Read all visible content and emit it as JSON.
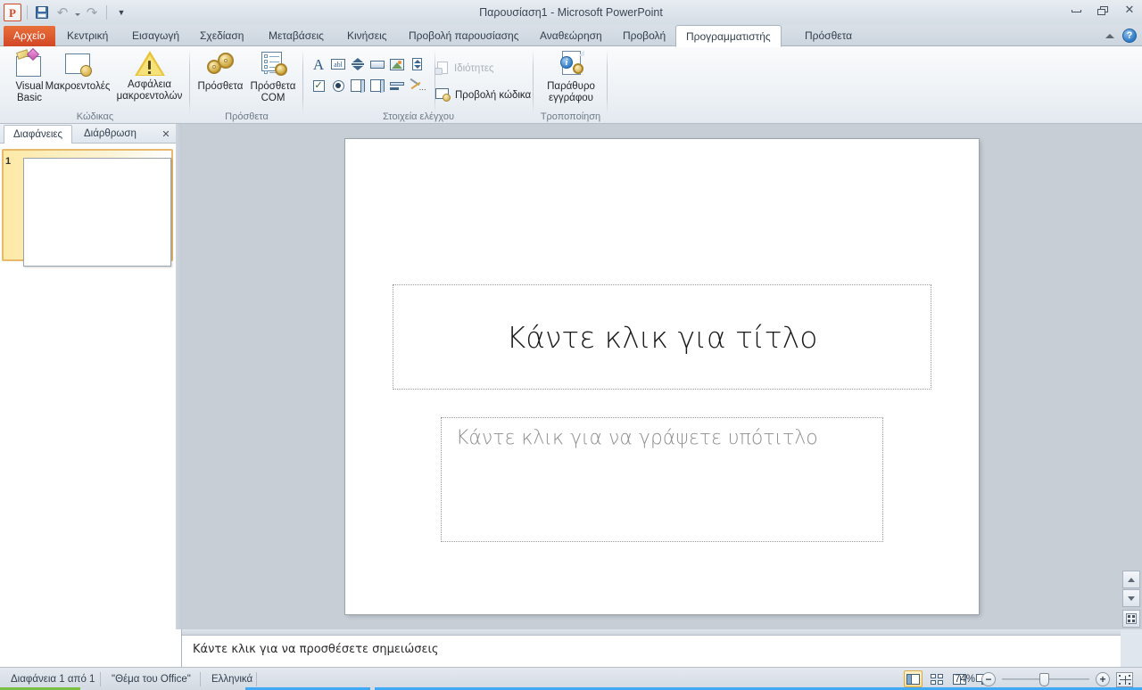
{
  "window": {
    "title": "Παρουσίαση1  -  Microsoft PowerPoint",
    "minimize": "Ελαχιστοποίηση",
    "restore": "Επαναφορά",
    "close": "✕"
  },
  "quick_access": {
    "logo": "P",
    "save": "Αποθήκευση",
    "undo": "↶",
    "undo_arrow": "▾",
    "redo": "↷",
    "customize": "▼"
  },
  "tabs": [
    {
      "label": "Αρχείο",
      "type": "file"
    },
    {
      "label": "Κεντρική",
      "type": "normal"
    },
    {
      "label": "Εισαγωγή",
      "type": "normal"
    },
    {
      "label": "Σχεδίαση",
      "type": "normal"
    },
    {
      "label": "Μεταβάσεις",
      "type": "normal"
    },
    {
      "label": "Κινήσεις",
      "type": "normal"
    },
    {
      "label": "Προβολή παρουσίασης",
      "type": "normal"
    },
    {
      "label": "Αναθεώρηση",
      "type": "normal"
    },
    {
      "label": "Προβολή",
      "type": "normal"
    },
    {
      "label": "Προγραμματιστής",
      "type": "active"
    },
    {
      "label": "Πρόσθετα",
      "type": "normal"
    }
  ],
  "tabstrip_right": {
    "collapse_ribbon": "Ελαχιστοποίηση κορδέλας",
    "help": "?"
  },
  "ribbon": {
    "groups": [
      {
        "name": "Κώδικας",
        "buttons": [
          {
            "label": "Visual\nBasic",
            "line1": "Visual",
            "line2": "Basic",
            "icon": "visual-basic-icon"
          },
          {
            "label": "Μακροεντολές",
            "line1": "Μακροεντολές",
            "line2": "",
            "icon": "macros-icon"
          },
          {
            "label": "Ασφάλεια μακροεντολών",
            "line1": "Ασφάλεια",
            "line2": "μακροεντολών",
            "icon": "macro-security-icon"
          }
        ]
      },
      {
        "name": "Πρόσθετα",
        "buttons": [
          {
            "label": "Πρόσθετα",
            "line1": "Πρόσθετα",
            "line2": "",
            "icon": "add-ins-icon"
          },
          {
            "label": "Πρόσθετα COM",
            "line1": "Πρόσθετα",
            "line2": "COM",
            "icon": "com-add-ins-icon"
          }
        ]
      },
      {
        "name": "Στοιχεία ελέγχου",
        "controls_row1": [
          "label-control-icon",
          "textbox-control-icon",
          "spin-button-icon",
          "command-button-icon",
          "image-control-icon",
          "scrollbar-control-icon"
        ],
        "controls_row2": [
          "checkbox-control-icon",
          "option-button-icon",
          "listbox-control-icon",
          "combobox-control-icon",
          "toggle-button-icon",
          "more-controls-icon"
        ],
        "properties_label": "Ιδιότητες",
        "view_code_label": "Προβολή κώδικα"
      },
      {
        "name": "Τροποποίηση",
        "buttons": [
          {
            "label": "Παράθυρο εγγράφου",
            "line1": "Παράθυρο",
            "line2": "εγγράφου",
            "icon": "document-panel-icon"
          }
        ]
      }
    ]
  },
  "slide_pane": {
    "tabs": [
      {
        "label": "Διαφάνειες",
        "active": true
      },
      {
        "label": "Διάρθρωση",
        "active": false
      }
    ],
    "close": "✕",
    "thumbnails": [
      {
        "number": "1",
        "selected": true
      }
    ]
  },
  "slide": {
    "title_placeholder": "Κάντε κλικ για τίτλο",
    "subtitle_placeholder": "Κάντε κλικ για να γράψετε υπότιτλο"
  },
  "notes": {
    "placeholder": "Κάντε κλικ για να προσθέσετε σημειώσεις"
  },
  "status_bar": {
    "slide_count": "Διαφάνεια 1 από 1",
    "theme": "\"Θέμα του Office\"",
    "language": "Ελληνικά",
    "views": [
      {
        "name": "normal-view",
        "label": "Κανονική προβολή",
        "selected": true
      },
      {
        "name": "slide-sorter-view",
        "label": "Ταξινόμηση διαφανειών",
        "selected": false
      },
      {
        "name": "reading-view",
        "label": "Προβολή ανάγνωσης",
        "selected": false
      },
      {
        "name": "slide-show-view",
        "label": "Προβολή παρουσίασης",
        "selected": false
      }
    ],
    "zoom_level": "74%",
    "zoom_out": "−",
    "zoom_in": "+",
    "fit_to_window": "Προσαρμογή διαφάνειας στο τρέχον παράθυρο"
  }
}
